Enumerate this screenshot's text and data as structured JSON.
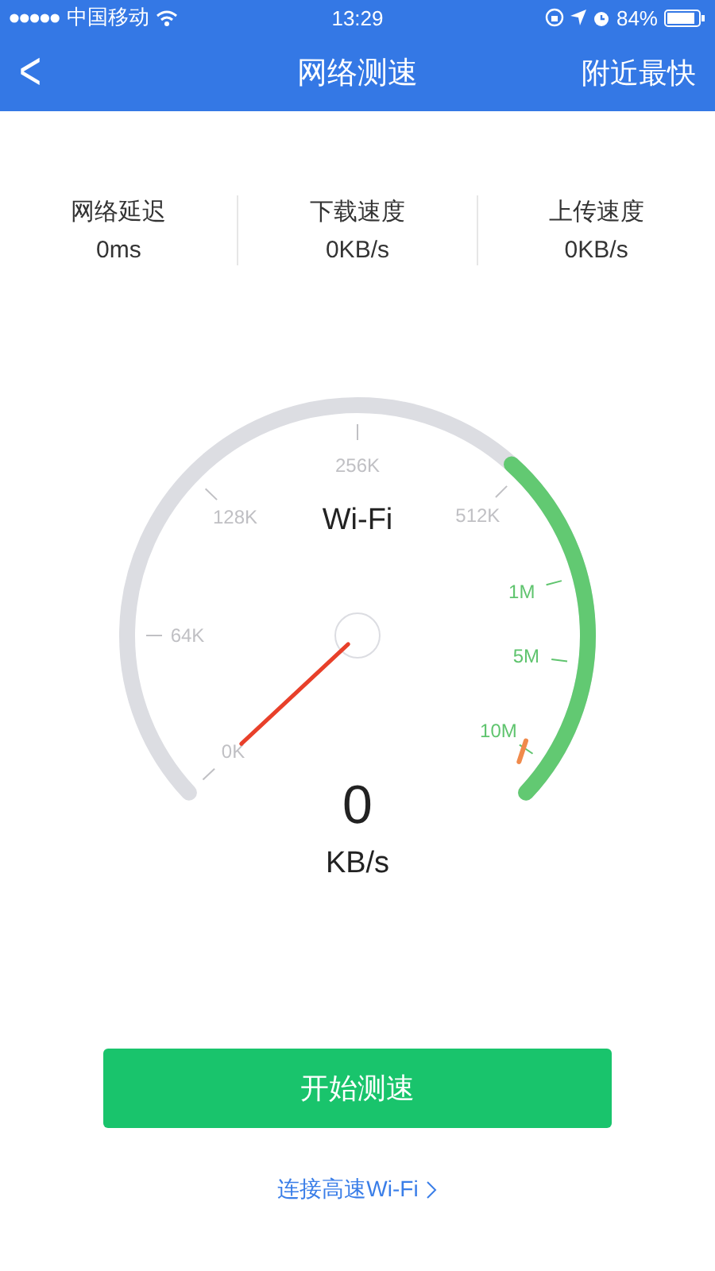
{
  "status_bar": {
    "carrier": "中国移动",
    "time": "13:29",
    "battery": "84%"
  },
  "nav": {
    "back": "<",
    "title": "网络测速",
    "action": "附近最快"
  },
  "stats": [
    {
      "label": "网络延迟",
      "value": "0ms"
    },
    {
      "label": "下载速度",
      "value": "0KB/s"
    },
    {
      "label": "上传速度",
      "value": "0KB/s"
    }
  ],
  "gauge": {
    "network": "Wi-Fi",
    "reading": "0",
    "unit": "KB/s",
    "ticks": [
      {
        "label": "0K",
        "color": "#c0c0c4"
      },
      {
        "label": "64K",
        "color": "#c0c0c4"
      },
      {
        "label": "128K",
        "color": "#c0c0c4"
      },
      {
        "label": "256K",
        "color": "#c0c0c4"
      },
      {
        "label": "512K",
        "color": "#c0c0c4"
      },
      {
        "label": "1M",
        "color": "#5fc46e"
      },
      {
        "label": "5M",
        "color": "#5fc46e"
      },
      {
        "label": "10M",
        "color": "#5fc46e"
      }
    ]
  },
  "start_button": "开始测速",
  "wifi_link": "连接高速Wi-Fi"
}
